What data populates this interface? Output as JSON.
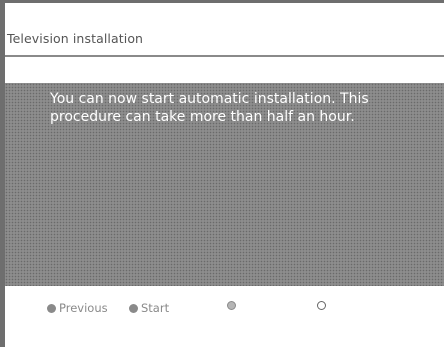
{
  "screen": {
    "title": "Television installation"
  },
  "message": {
    "text": "You can now start automatic installation. This procedure can take more than half an hour."
  },
  "footer": {
    "buttons": [
      {
        "label": "Previous",
        "icon": "red-dot-icon",
        "color": "#8a8a8a"
      },
      {
        "label": "Start",
        "icon": "green-dot-icon",
        "color": "#8a8a8a"
      },
      {
        "label": "",
        "icon": "yellow-dot-icon",
        "color": "#b5b5b5"
      },
      {
        "label": "",
        "icon": "blue-circle-icon",
        "color": "#ffffff"
      }
    ]
  },
  "colors": {
    "panel": "#858585",
    "message_text": "#ffffff",
    "title_text": "#555555",
    "footer_text": "#8a8a8a"
  }
}
